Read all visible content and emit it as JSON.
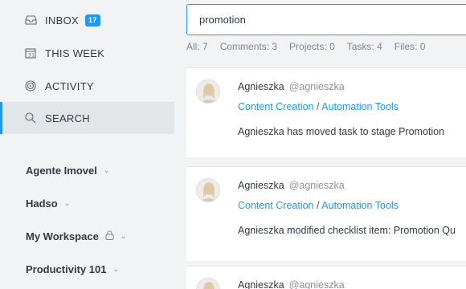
{
  "nav": [
    {
      "label": "INBOX",
      "icon": "inbox-icon",
      "badge": "17"
    },
    {
      "label": "THIS WEEK",
      "icon": "calendar-icon"
    },
    {
      "label": "ACTIVITY",
      "icon": "activity-icon"
    },
    {
      "label": "SEARCH",
      "icon": "search-icon",
      "active": true
    }
  ],
  "workspaces": [
    {
      "label": "Agente Imovel"
    },
    {
      "label": "Hadso"
    },
    {
      "label": "My Workspace",
      "locked": true
    },
    {
      "label": "Productivity 101"
    }
  ],
  "search": {
    "value": "promotion"
  },
  "filters": {
    "all": "All: 7",
    "comments": "Comments: 3",
    "projects": "Projects: 0",
    "tasks": "Tasks: 4",
    "files": "Files: 0"
  },
  "results": [
    {
      "name": "Agnieszka",
      "handle": "@agnieszka",
      "project": "Content Creation",
      "sep": "/",
      "list": "Automation Tools",
      "message": "Agnieszka has moved task to stage Promotion"
    },
    {
      "name": "Agnieszka",
      "handle": "@agnieszka",
      "project": "Content Creation",
      "sep": "/",
      "list": "Automation Tools",
      "message": "Agnieszka modified checklist item: Promotion Qu"
    },
    {
      "name": "Agnieszka",
      "handle": "@agnieszka"
    }
  ],
  "colors": {
    "accent": "#2196f3",
    "sidebar_bg": "#f1f3f5",
    "active_bg": "#e3e6e9"
  }
}
